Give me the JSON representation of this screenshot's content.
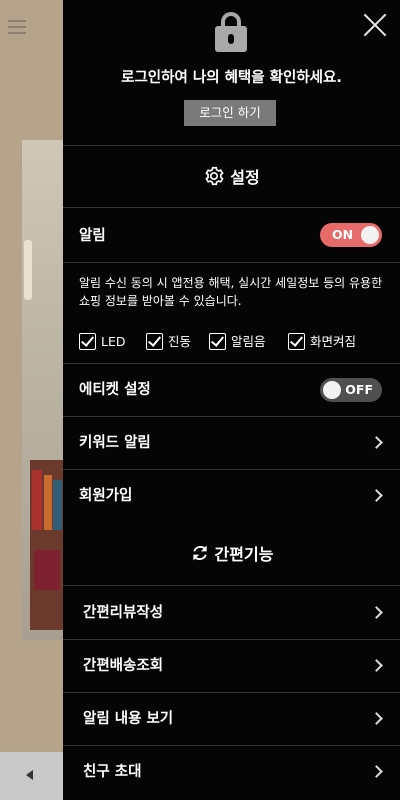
{
  "login": {
    "message": "로그인하여 나의 혜택을 확인하세요.",
    "button_label": "로그인 하기"
  },
  "settings": {
    "title": "설정",
    "notification_label": "알림",
    "notification_toggle": "ON",
    "description": "알림 수신 동의 시 앱전용 해택, 실시간 세일정보 등의 유용한 쇼핑 정보를 받아볼 수 있습니다.",
    "options": [
      {
        "label": "LED",
        "checked": true
      },
      {
        "label": "진동",
        "checked": true
      },
      {
        "label": "알림음",
        "checked": true
      },
      {
        "label": "화면켜짐",
        "checked": true
      }
    ],
    "etiquette_label": "에티켓 설정",
    "etiquette_toggle": "OFF",
    "keyword_label": "키워드 알림",
    "signup_label": "회원가입"
  },
  "quick": {
    "title": "간편기능",
    "items": [
      {
        "label": "간편리뷰작성"
      },
      {
        "label": "간편배송조회"
      },
      {
        "label": "알림 내용 보기"
      },
      {
        "label": "친구 초대"
      }
    ]
  },
  "colors": {
    "toggle_on": "#e86b6b",
    "toggle_off": "#505050",
    "drawer_bg": "#050505"
  },
  "icons": [
    "close-icon",
    "lock-icon",
    "gear-icon",
    "refresh-icon",
    "chevron-right-icon",
    "hamburger-icon",
    "back-arrow-icon"
  ]
}
